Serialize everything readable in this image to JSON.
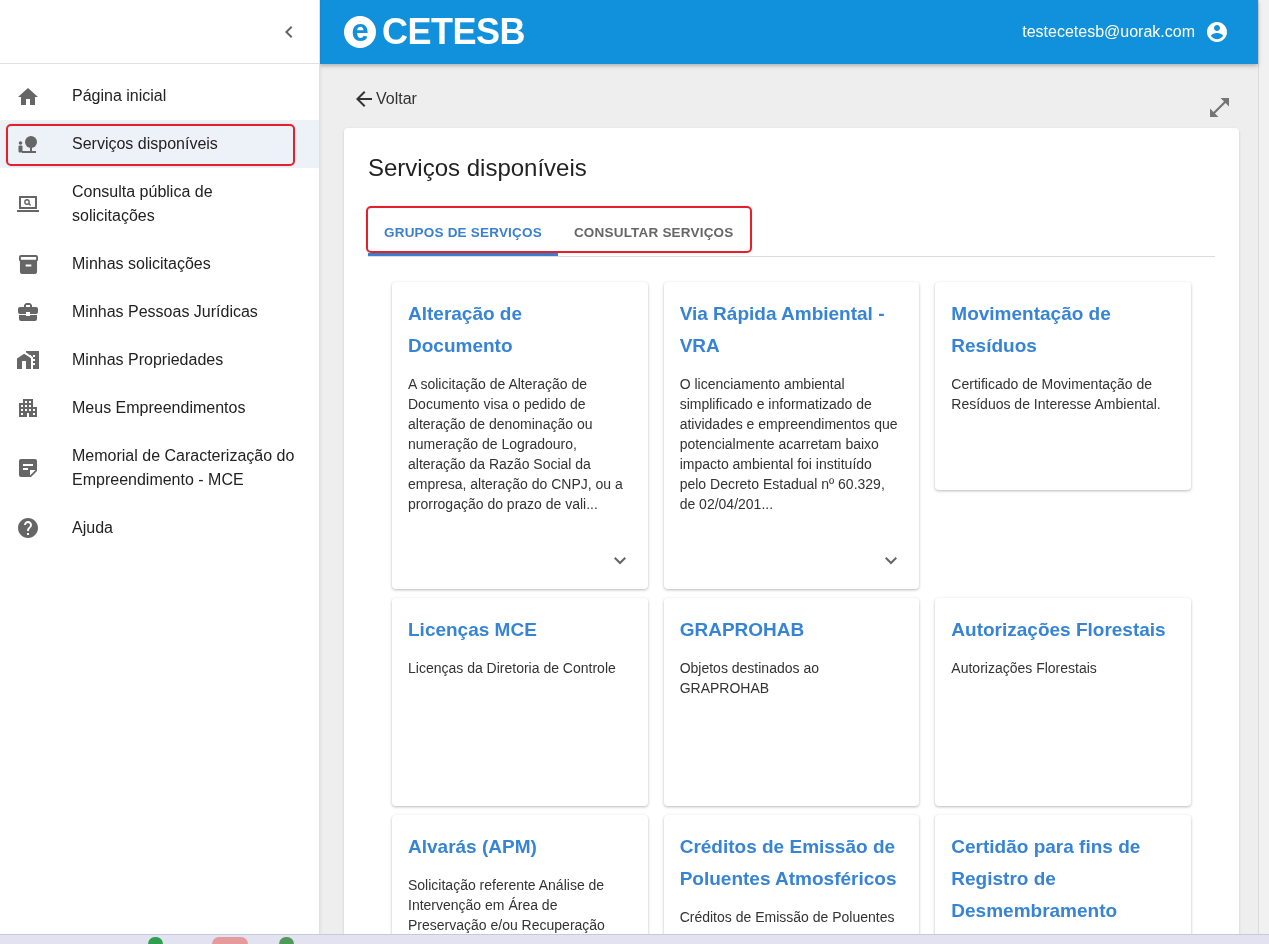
{
  "sidebar": {
    "items": [
      {
        "label": "Página inicial",
        "selected": false,
        "highlighted": false
      },
      {
        "label": "Serviços disponíveis",
        "selected": true,
        "highlighted": true
      },
      {
        "label": "Consulta pública de solicitações",
        "selected": false,
        "highlighted": false
      },
      {
        "label": "Minhas solicitações",
        "selected": false,
        "highlighted": false
      },
      {
        "label": "Minhas Pessoas Jurídicas",
        "selected": false,
        "highlighted": false
      },
      {
        "label": "Minhas Propriedades",
        "selected": false,
        "highlighted": false
      },
      {
        "label": "Meus Empreendimentos",
        "selected": false,
        "highlighted": false
      },
      {
        "label": "Memorial de Caracterização do Empreendimento - MCE",
        "selected": false,
        "highlighted": false
      },
      {
        "label": "Ajuda",
        "selected": false,
        "highlighted": false
      }
    ]
  },
  "header": {
    "logo": {
      "mark": "e",
      "name": "CETESB"
    },
    "user_email": "testecetesb@uorak.com"
  },
  "back_link": "Voltar",
  "panel": {
    "title": "Serviços disponíveis",
    "tabs": [
      {
        "label": "GRUPOS DE SERVIÇOS",
        "selected": true
      },
      {
        "label": "CONSULTAR SERVIÇOS",
        "selected": false
      }
    ],
    "tabs_highlighted": true,
    "groups": [
      {
        "title": "Alteração de Documento",
        "description": "A solicitação de Alteração de Documento visa o pedido de alteração de denominação ou numeração de Logradouro, alteração da Razão Social da empresa, alteração do CNPJ, ou a prorrogação do prazo de vali...",
        "expandable": true
      },
      {
        "title": "Via Rápida Ambiental - VRA",
        "description": "O licenciamento ambiental simplificado e informatizado de atividades e empreendimentos que potencialmente acarretam baixo impacto ambiental foi instituído pelo Decreto Estadual nº 60.329, de 02/04/201...",
        "expandable": true
      },
      {
        "title": "Movimentação de Resíduos",
        "description": "Certificado de Movimentação de Resíduos de Interesse Ambiental.",
        "expandable": false
      },
      {
        "title": "Licenças MCE",
        "description": "Licenças da Diretoria de Controle",
        "expandable": false
      },
      {
        "title": "GRAPROHAB",
        "description": "Objetos destinados ao GRAPROHAB",
        "expandable": false
      },
      {
        "title": "Autorizações Florestais",
        "description": "Autorizações Florestais",
        "expandable": false
      },
      {
        "title": "Alvarás (APM)",
        "description": "Solicitação referente Análise de Intervenção em Área de Preservação e/ou Recuperação",
        "expandable": false
      },
      {
        "title": "Créditos de Emissão de Poluentes Atmosféricos",
        "description": "Créditos de Emissão de Poluentes",
        "expandable": false
      },
      {
        "title": "Certidão para fins de Registro de Desmembramento",
        "expandable": false
      }
    ]
  }
}
